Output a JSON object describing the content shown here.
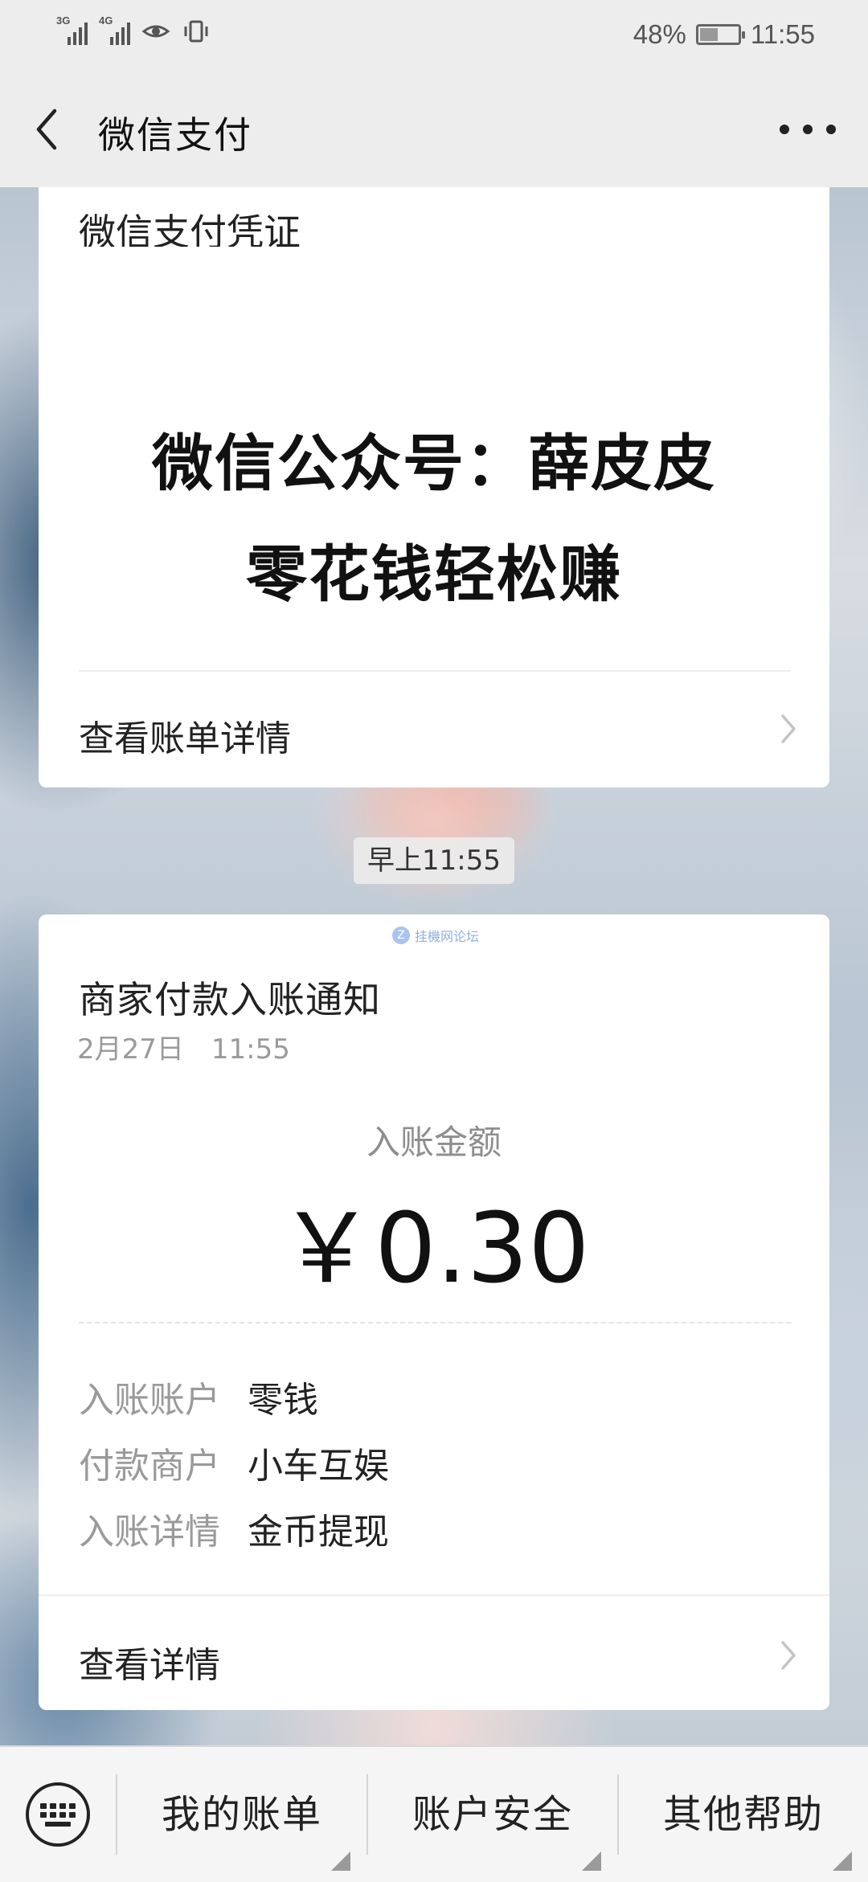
{
  "status_bar": {
    "signal_1_tag": "3G",
    "signal_2_tag": "4G",
    "battery_percent": "48%",
    "battery_level": 0.48,
    "time": "11:55"
  },
  "header": {
    "title": "微信支付"
  },
  "voucher_card": {
    "title": "微信支付凭证",
    "promo_line_1": "微信公众号：薛皮皮",
    "promo_line_2": "零花钱轻松赚",
    "link_label": "查看账单详情"
  },
  "timestamp": "早上11:55",
  "notice_card": {
    "watermark_text": "挂機网论坛",
    "title": "商家付款入账通知",
    "date": "2月27日　11:55",
    "amount_label": "入账金额",
    "amount": "￥0.30",
    "details": [
      {
        "key": "入账账户",
        "value": "零钱"
      },
      {
        "key": "付款商户",
        "value": "小车互娱"
      },
      {
        "key": "入账详情",
        "value": "金币提现"
      }
    ],
    "link_label": "查看详情"
  },
  "bottom_menu": {
    "items": [
      "我的账单",
      "账户安全",
      "其他帮助"
    ]
  }
}
